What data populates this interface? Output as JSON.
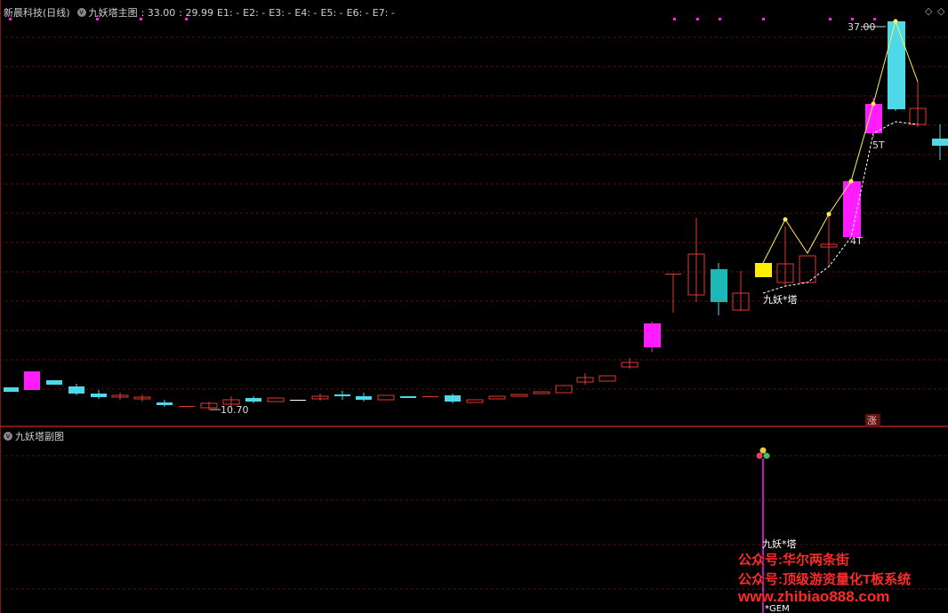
{
  "header": {
    "stock": "新晨科技(日线)",
    "indicator": "九妖塔主图",
    "v1": ": 33.00",
    "v2": ": 29.99",
    "e": [
      "E1: -",
      "E2: -",
      "E3: -",
      "E4: -",
      "E5: -",
      "E6: -",
      "E7: -"
    ],
    "ctrl_left": "◇",
    "ctrl_right": "◇"
  },
  "main_labels": {
    "high": "37.00",
    "low": "10.70",
    "t5": "5T",
    "t4": "4T",
    "tower": "九妖*塔",
    "zhang": "涨"
  },
  "sub": {
    "title": "九妖塔副图",
    "tower": "九妖*塔",
    "gem": "*GEM"
  },
  "watermark": {
    "line1": "公众号:华尔两条街",
    "line2": "公众号:顶级游资量化T板系统",
    "line3": "www.zhibiao888.com"
  },
  "colors": {
    "up": "#e53935",
    "down_cyan": "#4fd9e8",
    "magenta": "#ff1cff",
    "yellow": "#ffee00",
    "grid": "#5a1010"
  }
}
